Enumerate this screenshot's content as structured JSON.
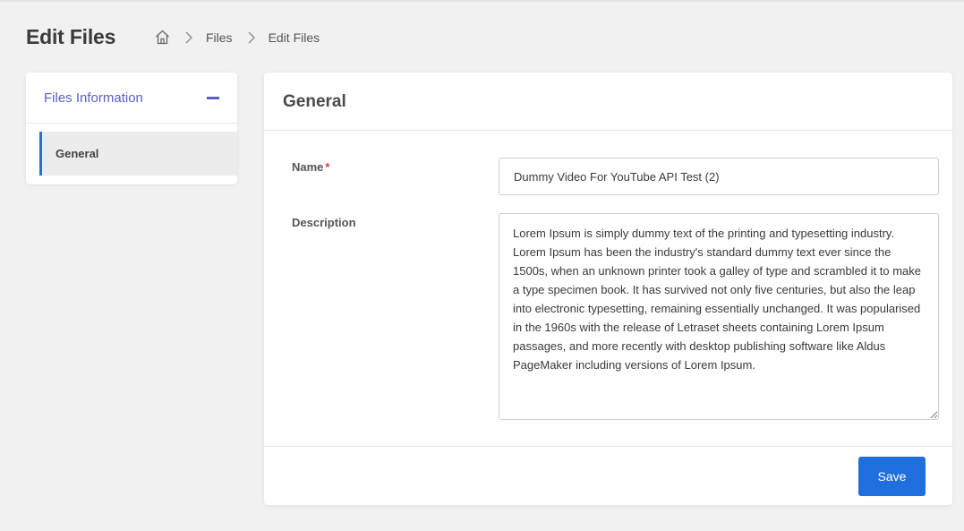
{
  "header": {
    "title": "Edit Files",
    "breadcrumb": {
      "home_icon": "home-icon",
      "items": [
        "Files",
        "Edit Files"
      ]
    }
  },
  "sidebar": {
    "section_title": "Files Information",
    "collapse_icon": "minus-icon",
    "items": [
      {
        "label": "General",
        "active": true
      }
    ]
  },
  "main": {
    "title": "General",
    "fields": {
      "name": {
        "label": "Name",
        "required_marker": "*",
        "value": "Dummy Video For YouTube API Test (2)"
      },
      "description": {
        "label": "Description",
        "value": "Lorem Ipsum is simply dummy text of the printing and typesetting industry. Lorem Ipsum has been the industry's standard dummy text ever since the 1500s, when an unknown printer took a galley of type and scrambled it to make a type specimen book. It has survived not only five centuries, but also the leap into electronic typesetting, remaining essentially unchanged. It was popularised in the 1960s with the release of Letraset sheets containing Lorem Ipsum passages, and more recently with desktop publishing software like Aldus PageMaker including versions of Lorem Ipsum."
      }
    },
    "save_label": "Save"
  },
  "colors": {
    "accent": "#5c5cc7",
    "primary_button": "#1f6fde",
    "active_indicator": "#2a6fd6",
    "required": "#e03b3b"
  }
}
